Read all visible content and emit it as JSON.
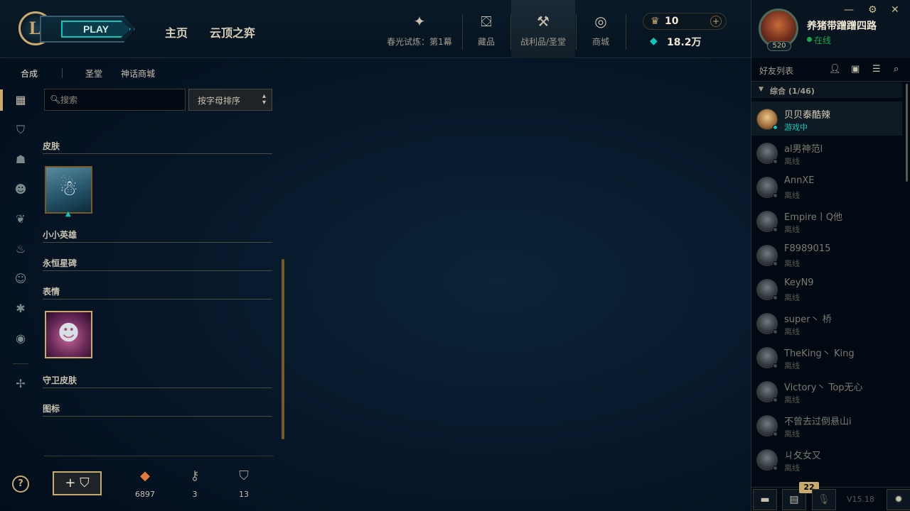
{
  "topbar": {
    "play_label": "PLAY",
    "nav": [
      "主页",
      "云顶之弈"
    ],
    "icons": [
      {
        "name": "event-pass",
        "icon": "✦",
        "label": "春光试炼：第1幕"
      },
      {
        "name": "collection",
        "icon": "⛋",
        "label": "藏品"
      },
      {
        "name": "loot-sanctum",
        "icon": "⚒",
        "label": "战利品/圣堂"
      },
      {
        "name": "store",
        "icon": "◎",
        "label": "商城"
      }
    ],
    "rp_value": "10",
    "be_value": "18.2万"
  },
  "profile": {
    "name": "养猪带蹭蹭四路",
    "status": "在线",
    "level": "520"
  },
  "subnav": {
    "tabs": [
      "合成",
      "圣堂",
      "神话商城"
    ]
  },
  "main": {
    "search_placeholder": "搜索",
    "sort_label": "按字母排序",
    "categories": [
      "皮肤",
      "小小英雄",
      "永恒星碑",
      "表情",
      "守卫皮肤",
      "图标"
    ],
    "stats": [
      {
        "icon": "◆",
        "value": "6897",
        "color": "#e07a3a"
      },
      {
        "icon": "⚷",
        "value": "3",
        "color": "#a09b8c"
      },
      {
        "icon": "⛉",
        "value": "13",
        "color": "#a09b8c"
      }
    ],
    "add_label": "+ ⛉",
    "help_label": "?"
  },
  "friends": {
    "title": "好友列表",
    "group_label": "综合 (1/46)",
    "list": [
      {
        "name": "贝贝泰酷辣",
        "status": "游戏中",
        "ingame": true
      },
      {
        "name": "al男神范l",
        "status": "离线",
        "ingame": false
      },
      {
        "name": "AnnXE",
        "status": "离线",
        "ingame": false
      },
      {
        "name": "Empire丨Q他",
        "status": "离线",
        "ingame": false
      },
      {
        "name": "F8989015",
        "status": "离线",
        "ingame": false
      },
      {
        "name": "KeyN9",
        "status": "离线",
        "ingame": false
      },
      {
        "name": "super丶 桥",
        "status": "离线",
        "ingame": false
      },
      {
        "name": "TheKing丶 King",
        "status": "离线",
        "ingame": false
      },
      {
        "name": "Victory丶 Top无心",
        "status": "离线",
        "ingame": false
      },
      {
        "name": "不曾去过倒悬山i",
        "status": "离线",
        "ingame": false
      },
      {
        "name": "ㄐ夂女又",
        "status": "离线",
        "ingame": false
      }
    ],
    "badge_count": "22",
    "version": "V15.18"
  }
}
